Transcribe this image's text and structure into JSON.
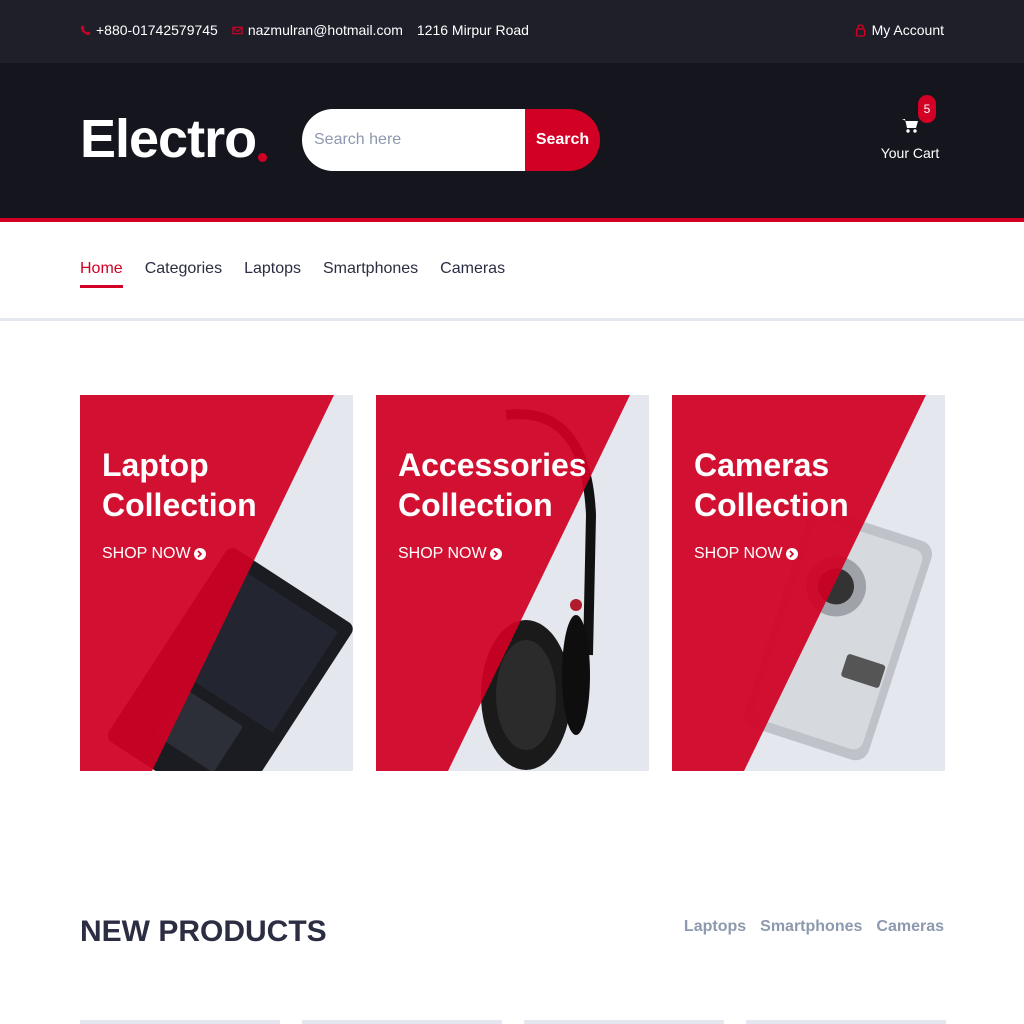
{
  "top_bar": {
    "phone": "+880-01742579745",
    "email": "nazmulran@hotmail.com",
    "address": "1216 Mirpur Road",
    "account": "My Account"
  },
  "header": {
    "logo": "Electro",
    "search": {
      "placeholder": "Search here",
      "value": "",
      "button": "Search"
    },
    "cart": {
      "label": "Your Cart",
      "count": "5"
    }
  },
  "nav": {
    "items": [
      {
        "label": "Home",
        "active": true
      },
      {
        "label": "Categories"
      },
      {
        "label": "Laptops"
      },
      {
        "label": "Smartphones"
      },
      {
        "label": "Cameras"
      }
    ]
  },
  "collections": [
    {
      "line1": "Laptop",
      "line2": "Collection",
      "cta": "SHOP NOW",
      "icon": "laptop-image"
    },
    {
      "line1": "Accessories",
      "line2": "Collection",
      "cta": "SHOP NOW",
      "icon": "headphones-image"
    },
    {
      "line1": "Cameras",
      "line2": "Collection",
      "cta": "SHOP NOW",
      "icon": "camera-image"
    }
  ],
  "new_products": {
    "title": "NEW PRODUCTS",
    "tabs": [
      "Laptops",
      "Smartphones",
      "Cameras"
    ]
  },
  "colors": {
    "accent": "#d10024",
    "topbar": "#1e1f29",
    "header": "#15161d",
    "muted": "#8d99ae",
    "text": "#2b2d42"
  }
}
